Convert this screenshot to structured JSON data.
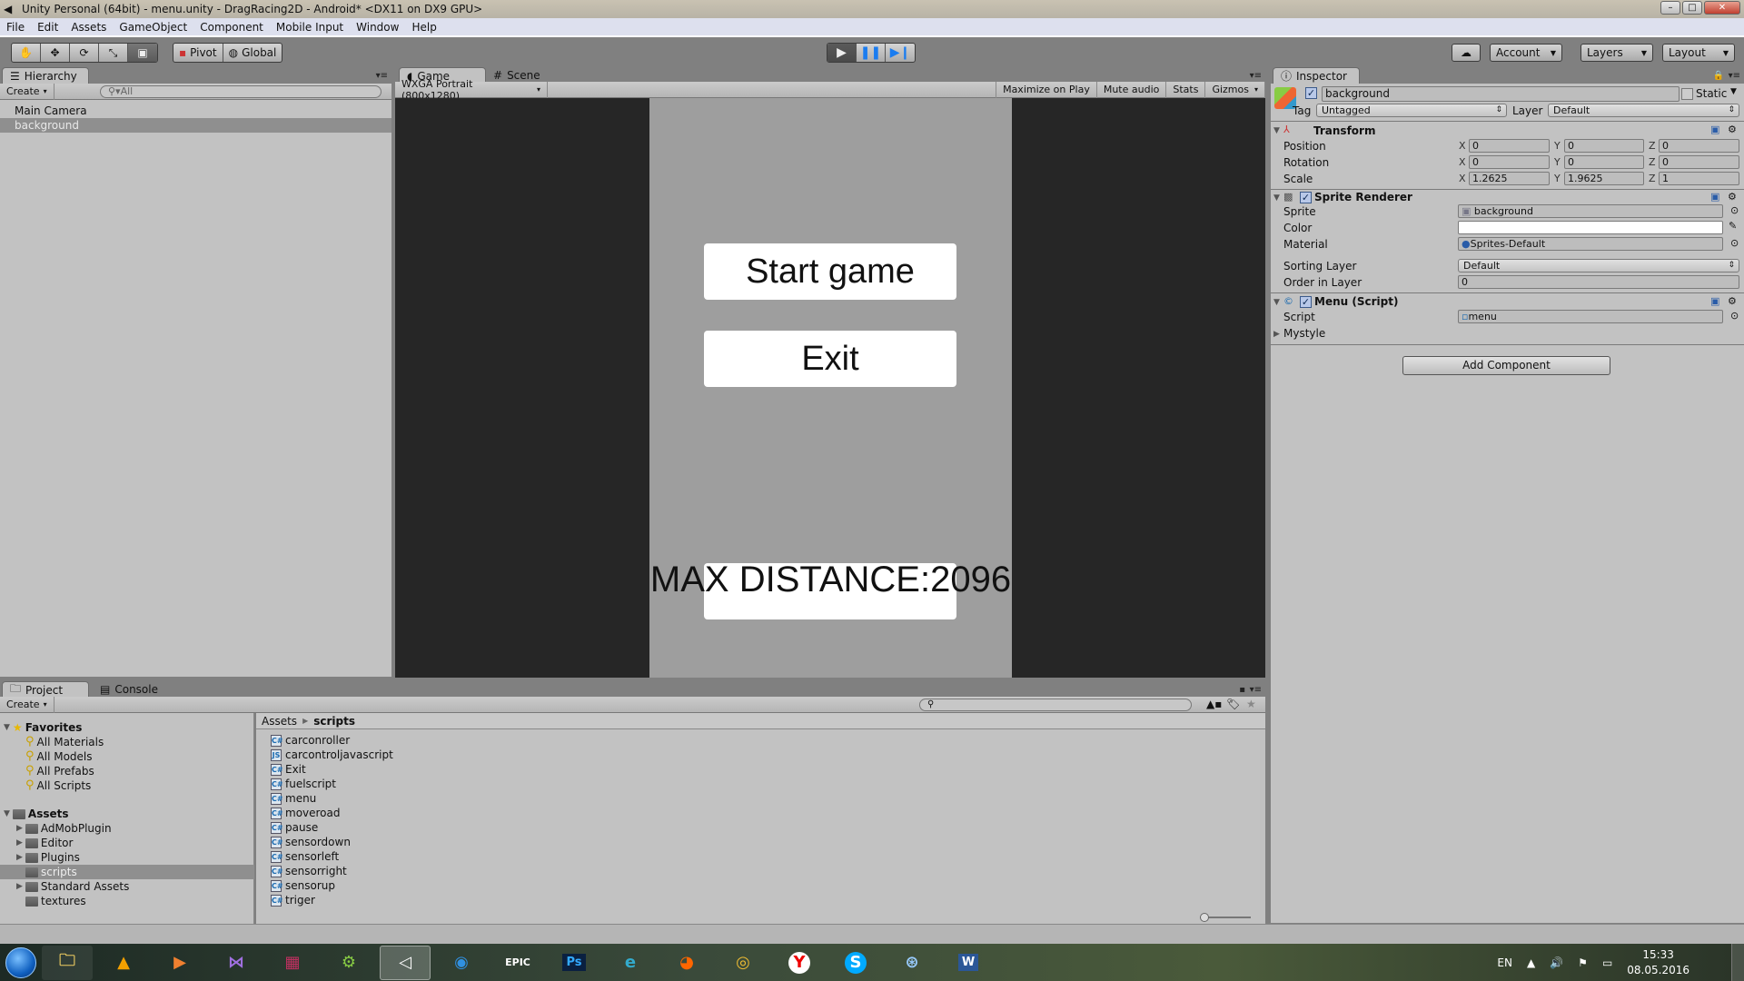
{
  "window": {
    "title": "Unity Personal (64bit) - menu.unity - DragRacing2D - Android* <DX11 on DX9 GPU>",
    "controls": [
      "minimize",
      "maximize",
      "close"
    ]
  },
  "menubar": [
    "File",
    "Edit",
    "Assets",
    "GameObject",
    "Component",
    "Mobile Input",
    "Window",
    "Help"
  ],
  "toolbar": {
    "tools": [
      "hand-tool",
      "move-tool",
      "rotate-tool",
      "scale-tool",
      "rect-tool"
    ],
    "pivot_label": "Pivot",
    "global_label": "Global",
    "play_controls": [
      "play",
      "pause",
      "step"
    ],
    "account_label": "Account",
    "layers_label": "Layers",
    "layout_label": "Layout"
  },
  "hierarchy": {
    "tab_label": "Hierarchy",
    "create_label": "Create",
    "search_placeholder": "All",
    "items": [
      {
        "label": "Main Camera",
        "selected": false
      },
      {
        "label": "background",
        "selected": true
      }
    ]
  },
  "game_view": {
    "tabs": [
      {
        "label": "Game",
        "active": true
      },
      {
        "label": "Scene",
        "active": false
      }
    ],
    "resolution": "WXGA Portrait (800x1280)",
    "options": [
      "Maximize on Play",
      "Mute audio",
      "Stats",
      "Gizmos"
    ],
    "game": {
      "start_button": "Start game",
      "exit_button": "Exit",
      "max_distance": "MAX DISTANCE:2096"
    }
  },
  "inspector": {
    "tab_label": "Inspector",
    "object_name": "background",
    "active": true,
    "static_label": "Static",
    "static": false,
    "tag_label": "Tag",
    "tag_value": "Untagged",
    "layer_label": "Layer",
    "layer_value": "Default",
    "transform": {
      "title": "Transform",
      "position": {
        "label": "Position",
        "x": "0",
        "y": "0",
        "z": "0"
      },
      "rotation": {
        "label": "Rotation",
        "x": "0",
        "y": "0",
        "z": "0"
      },
      "scale": {
        "label": "Scale",
        "x": "1.2625",
        "y": "1.9625",
        "z": "1"
      }
    },
    "sprite_renderer": {
      "title": "Sprite Renderer",
      "sprite_label": "Sprite",
      "sprite_value": "background",
      "color_label": "Color",
      "color_value": "#ffffff",
      "material_label": "Material",
      "material_value": "Sprites-Default",
      "sorting_layer_label": "Sorting Layer",
      "sorting_layer_value": "Default",
      "order_label": "Order in Layer",
      "order_value": "0"
    },
    "menu_script": {
      "title": "Menu (Script)",
      "script_label": "Script",
      "script_value": "menu",
      "mystyle_label": "Mystyle"
    },
    "add_component_label": "Add Component"
  },
  "project": {
    "tabs": [
      {
        "label": "Project",
        "active": true
      },
      {
        "label": "Console",
        "active": false
      }
    ],
    "create_label": "Create",
    "favorites_label": "Favorites",
    "favorites": [
      "All Materials",
      "All Models",
      "All Prefabs",
      "All Scripts"
    ],
    "assets_label": "Assets",
    "folders": [
      {
        "label": "AdMobPlugin",
        "expandable": true,
        "selected": false
      },
      {
        "label": "Editor",
        "expandable": true,
        "selected": false
      },
      {
        "label": "Plugins",
        "expandable": true,
        "selected": false
      },
      {
        "label": "scripts",
        "expandable": false,
        "selected": true
      },
      {
        "label": "Standard Assets",
        "expandable": true,
        "selected": false
      },
      {
        "label": "textures",
        "expandable": false,
        "selected": false
      }
    ],
    "breadcrumb": [
      "Assets",
      "scripts"
    ],
    "files": [
      {
        "name": "carconroller",
        "type": "cs"
      },
      {
        "name": "carcontroljavascript",
        "type": "js"
      },
      {
        "name": "Exit",
        "type": "cs"
      },
      {
        "name": "fuelscript",
        "type": "cs"
      },
      {
        "name": "menu",
        "type": "cs"
      },
      {
        "name": "moveroad",
        "type": "cs"
      },
      {
        "name": "pause",
        "type": "cs"
      },
      {
        "name": "sensordown",
        "type": "cs"
      },
      {
        "name": "sensorleft",
        "type": "cs"
      },
      {
        "name": "sensorright",
        "type": "cs"
      },
      {
        "name": "sensorup",
        "type": "cs"
      },
      {
        "name": "triger",
        "type": "cs"
      }
    ]
  },
  "taskbar": {
    "apps": [
      "Explorer",
      "AIMP",
      "Media Player",
      "Visual Studio",
      "WinRAR",
      "Android Studio",
      "Unity",
      "TeamViewer",
      "Epic Games",
      "Photoshop",
      "Internet Explorer",
      "Firefox",
      "Chrome",
      "Yandex",
      "Skype",
      "Network",
      "Word"
    ],
    "active_app": "Unity",
    "language": "EN",
    "time": "15:33",
    "date": "08.05.2016"
  }
}
